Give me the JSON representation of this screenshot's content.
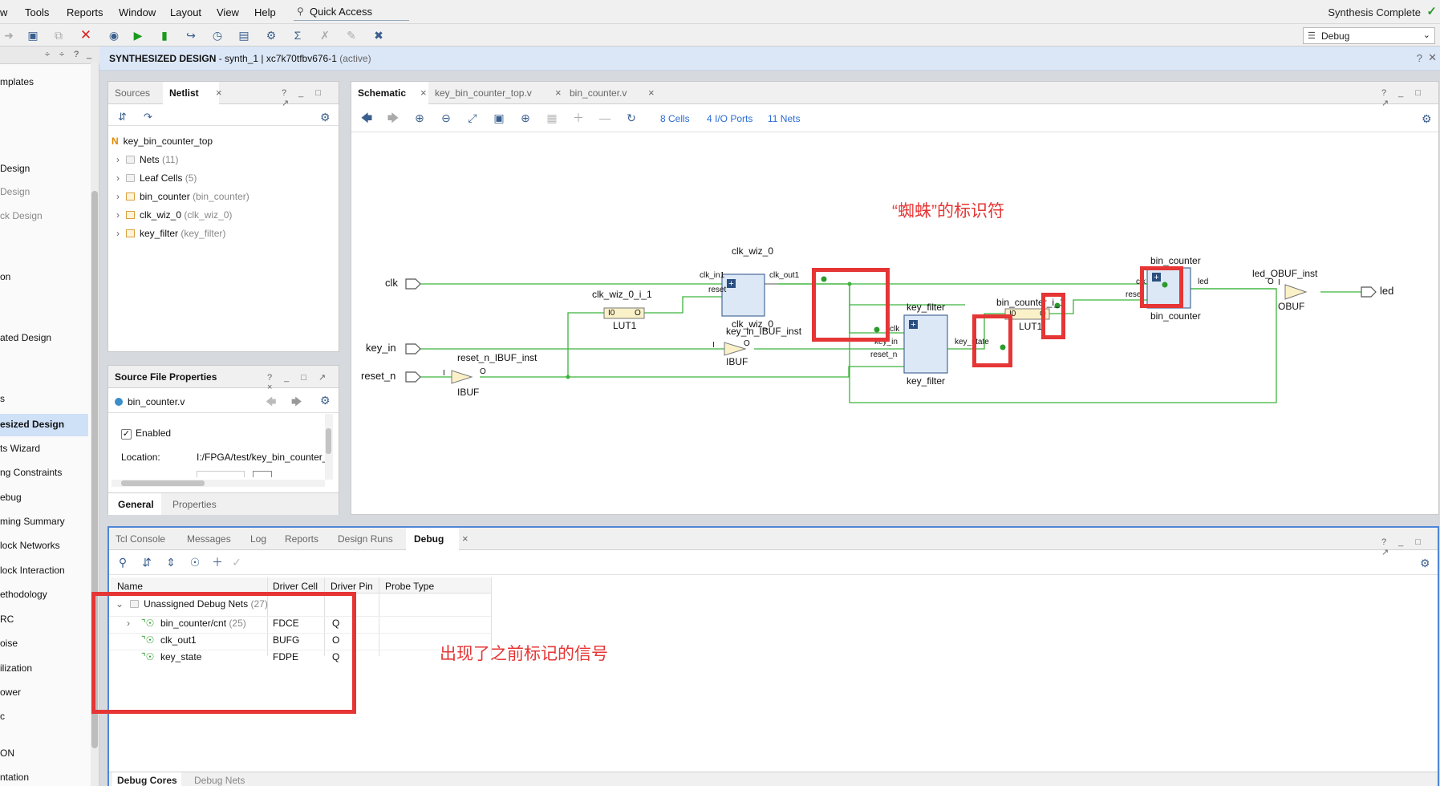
{
  "menu": {
    "items": [
      "w",
      "Tools",
      "Reports",
      "Window",
      "Layout",
      "View",
      "Help"
    ],
    "quick_access": "Quick Access",
    "status": "Synthesis Complete"
  },
  "toolbar": {
    "layout_select": "Debug"
  },
  "flow": {
    "header_controls": [
      "÷",
      "÷",
      "?",
      "_"
    ],
    "items": [
      {
        "label": "mplates",
        "style": "n"
      },
      {
        "label": "Design",
        "style": "n"
      },
      {
        "label": "Design",
        "style": "g"
      },
      {
        "label": "ck Design",
        "style": "g"
      },
      {
        "label": "on",
        "style": "n"
      },
      {
        "label": "ated Design",
        "style": "n"
      },
      {
        "label": "s",
        "style": "n"
      },
      {
        "label": "esized Design",
        "style": "b"
      },
      {
        "label": "ts Wizard",
        "style": "n"
      },
      {
        "label": "ng Constraints",
        "style": "n"
      },
      {
        "label": "ebug",
        "style": "n"
      },
      {
        "label": "ming Summary",
        "style": "n"
      },
      {
        "label": "lock Networks",
        "style": "n"
      },
      {
        "label": "lock Interaction",
        "style": "n"
      },
      {
        "label": "ethodology",
        "style": "n"
      },
      {
        "label": "RC",
        "style": "n"
      },
      {
        "label": "oise",
        "style": "n"
      },
      {
        "label": "ilization",
        "style": "n"
      },
      {
        "label": "ower",
        "style": "n"
      },
      {
        "label": "c",
        "style": "n"
      },
      {
        "label": "ON",
        "style": "n"
      },
      {
        "label": "ntation",
        "style": "n"
      }
    ]
  },
  "design_header": {
    "title": "SYNTHESIZED DESIGN",
    "detail": " - synth_1 | xc7k70tfbv676-1 ",
    "status": "(active)"
  },
  "netlist": {
    "tabs": [
      "Sources",
      "Netlist"
    ],
    "top": "key_bin_counter_top",
    "top_icon": "N",
    "nodes": [
      {
        "name": "Nets",
        "extra": "(11)",
        "kind": "fold"
      },
      {
        "name": "Leaf Cells",
        "extra": "(5)",
        "kind": "fold"
      },
      {
        "name": "bin_counter",
        "extra": "(bin_counter)",
        "kind": "cell"
      },
      {
        "name": "clk_wiz_0",
        "extra": "(clk_wiz_0)",
        "kind": "cell"
      },
      {
        "name": "key_filter",
        "extra": "(key_filter)",
        "kind": "cell"
      }
    ]
  },
  "sfp": {
    "title": "Source File Properties",
    "file": "bin_counter.v",
    "enabled": "Enabled",
    "location_label": "Location:",
    "location_value": "I:/FPGA/test/key_bin_counter_t",
    "tabs": [
      "General",
      "Properties"
    ]
  },
  "schematic": {
    "tabs": [
      "Schematic",
      "key_bin_counter_top.v",
      "bin_counter.v"
    ],
    "stats": [
      "8 Cells",
      "4 I/O Ports",
      "11 Nets"
    ],
    "annotation": "“蜘蛛”的标识符",
    "ports": {
      "clk": "clk",
      "key_in": "key_in",
      "reset_n": "reset_n",
      "led": "led"
    },
    "instances": {
      "clk_wiz_top": "clk_wiz_0",
      "clk_wiz_bot": "clk_wiz_0",
      "clk_in1": "clk_in1",
      "clk_reset": "reset",
      "clk_out1": "clk_out1",
      "lut1_inst": "clk_wiz_0_i_1",
      "lut1_i0": "I0",
      "lut1_o": "O",
      "lut1_type": "LUT1",
      "key_ibuf_inst": "key_in_IBUF_inst",
      "ibuf_i": "I",
      "ibuf_o": "O",
      "ibuf_type": "IBUF",
      "reset_ibuf_inst": "reset_n_IBUF_inst",
      "reset_ibuf_i": "I",
      "reset_ibuf_o": "O",
      "reset_ibuf_type": "IBUF",
      "key_filter_top": "key_filter",
      "key_filter_bot": "key_filter",
      "kf_clk": "clk",
      "kf_key_in": "key_in",
      "kf_reset_n": "reset_n",
      "kf_key_state": "key_state",
      "lut2_inst": "bin_counter_i_1",
      "lut2_i0": "I0",
      "lut2_o": "O",
      "lut2_type": "LUT1",
      "bin_top": "bin_counter",
      "bin_bot": "bin_counter",
      "bin_clk": "clk",
      "bin_reset": "reset",
      "bin_led": "led",
      "obuf_inst": "led_OBUF_inst",
      "obuf_i": "I",
      "obuf_o": "O",
      "obuf_type": "OBUF"
    }
  },
  "debug": {
    "tabs": [
      "Tcl Console",
      "Messages",
      "Log",
      "Reports",
      "Design Runs",
      "Debug"
    ],
    "columns": [
      "Name",
      "Driver Cell",
      "Driver Pin",
      "Probe Type"
    ],
    "group": {
      "name": "Unassigned Debug Nets",
      "count": "(27)"
    },
    "rows": [
      {
        "name": "bin_counter/cnt",
        "extra": "(25)",
        "cell": "FDCE",
        "pin": "Q"
      },
      {
        "name": "clk_out1",
        "extra": "",
        "cell": "BUFG",
        "pin": "O"
      },
      {
        "name": "key_state",
        "extra": "",
        "cell": "FDPE",
        "pin": "Q"
      }
    ],
    "annotation": "出现了之前标记的信号",
    "bottom_tabs": [
      "Debug Cores",
      "Debug Nets"
    ]
  },
  "colors": {
    "wire": "#3cb43c",
    "cell_fill": "#dce8f6",
    "cell_stroke": "#4a6a9a",
    "lut_fill": "#fbf1c8",
    "buf_fill": "#fbf1c8",
    "highlight": "#e53535",
    "link": "#2a6bd6"
  }
}
